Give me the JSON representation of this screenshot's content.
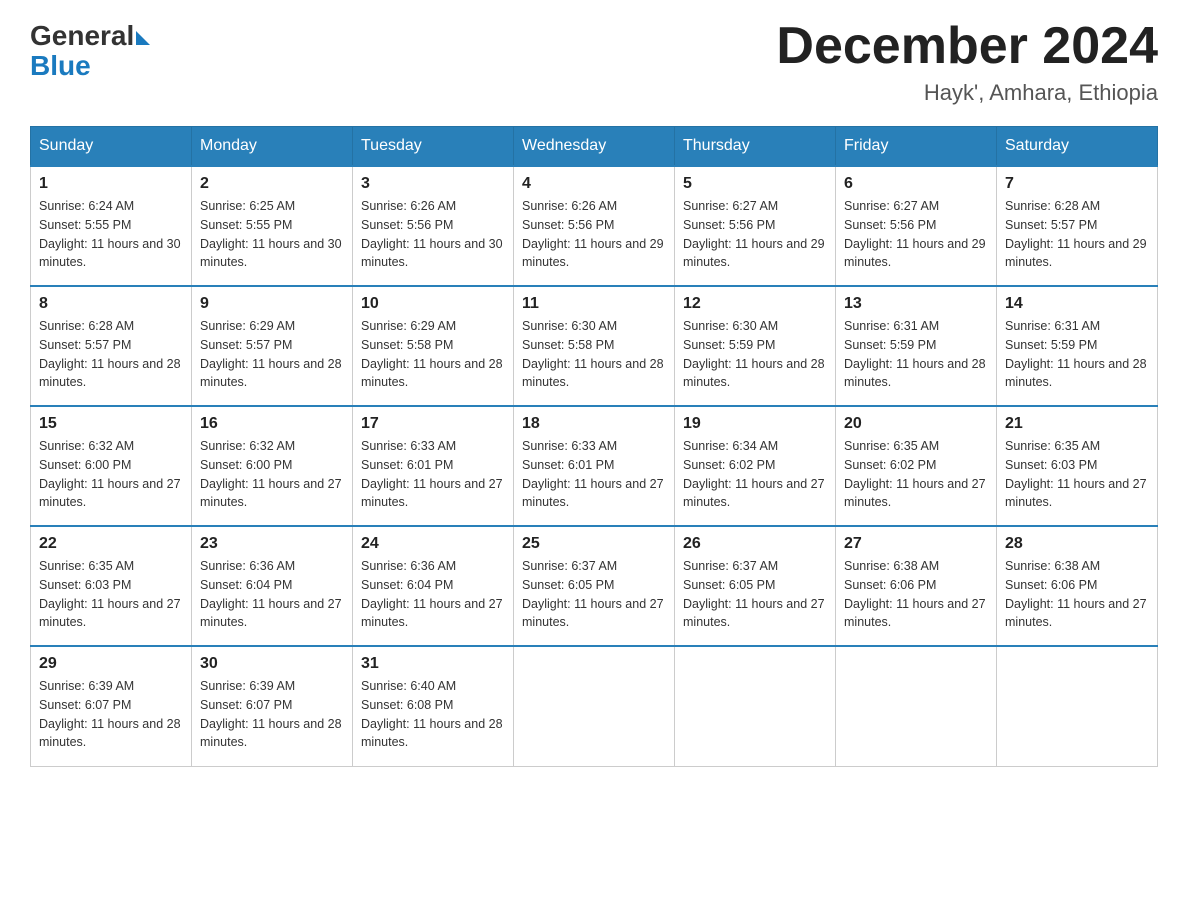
{
  "header": {
    "logo_general": "General",
    "logo_blue": "Blue",
    "month_year": "December 2024",
    "location": "Hayk', Amhara, Ethiopia"
  },
  "weekdays": [
    "Sunday",
    "Monday",
    "Tuesday",
    "Wednesday",
    "Thursday",
    "Friday",
    "Saturday"
  ],
  "weeks": [
    [
      {
        "day": "1",
        "sunrise": "6:24 AM",
        "sunset": "5:55 PM",
        "daylight": "11 hours and 30 minutes."
      },
      {
        "day": "2",
        "sunrise": "6:25 AM",
        "sunset": "5:55 PM",
        "daylight": "11 hours and 30 minutes."
      },
      {
        "day": "3",
        "sunrise": "6:26 AM",
        "sunset": "5:56 PM",
        "daylight": "11 hours and 30 minutes."
      },
      {
        "day": "4",
        "sunrise": "6:26 AM",
        "sunset": "5:56 PM",
        "daylight": "11 hours and 29 minutes."
      },
      {
        "day": "5",
        "sunrise": "6:27 AM",
        "sunset": "5:56 PM",
        "daylight": "11 hours and 29 minutes."
      },
      {
        "day": "6",
        "sunrise": "6:27 AM",
        "sunset": "5:56 PM",
        "daylight": "11 hours and 29 minutes."
      },
      {
        "day": "7",
        "sunrise": "6:28 AM",
        "sunset": "5:57 PM",
        "daylight": "11 hours and 29 minutes."
      }
    ],
    [
      {
        "day": "8",
        "sunrise": "6:28 AM",
        "sunset": "5:57 PM",
        "daylight": "11 hours and 28 minutes."
      },
      {
        "day": "9",
        "sunrise": "6:29 AM",
        "sunset": "5:57 PM",
        "daylight": "11 hours and 28 minutes."
      },
      {
        "day": "10",
        "sunrise": "6:29 AM",
        "sunset": "5:58 PM",
        "daylight": "11 hours and 28 minutes."
      },
      {
        "day": "11",
        "sunrise": "6:30 AM",
        "sunset": "5:58 PM",
        "daylight": "11 hours and 28 minutes."
      },
      {
        "day": "12",
        "sunrise": "6:30 AM",
        "sunset": "5:59 PM",
        "daylight": "11 hours and 28 minutes."
      },
      {
        "day": "13",
        "sunrise": "6:31 AM",
        "sunset": "5:59 PM",
        "daylight": "11 hours and 28 minutes."
      },
      {
        "day": "14",
        "sunrise": "6:31 AM",
        "sunset": "5:59 PM",
        "daylight": "11 hours and 28 minutes."
      }
    ],
    [
      {
        "day": "15",
        "sunrise": "6:32 AM",
        "sunset": "6:00 PM",
        "daylight": "11 hours and 27 minutes."
      },
      {
        "day": "16",
        "sunrise": "6:32 AM",
        "sunset": "6:00 PM",
        "daylight": "11 hours and 27 minutes."
      },
      {
        "day": "17",
        "sunrise": "6:33 AM",
        "sunset": "6:01 PM",
        "daylight": "11 hours and 27 minutes."
      },
      {
        "day": "18",
        "sunrise": "6:33 AM",
        "sunset": "6:01 PM",
        "daylight": "11 hours and 27 minutes."
      },
      {
        "day": "19",
        "sunrise": "6:34 AM",
        "sunset": "6:02 PM",
        "daylight": "11 hours and 27 minutes."
      },
      {
        "day": "20",
        "sunrise": "6:35 AM",
        "sunset": "6:02 PM",
        "daylight": "11 hours and 27 minutes."
      },
      {
        "day": "21",
        "sunrise": "6:35 AM",
        "sunset": "6:03 PM",
        "daylight": "11 hours and 27 minutes."
      }
    ],
    [
      {
        "day": "22",
        "sunrise": "6:35 AM",
        "sunset": "6:03 PM",
        "daylight": "11 hours and 27 minutes."
      },
      {
        "day": "23",
        "sunrise": "6:36 AM",
        "sunset": "6:04 PM",
        "daylight": "11 hours and 27 minutes."
      },
      {
        "day": "24",
        "sunrise": "6:36 AM",
        "sunset": "6:04 PM",
        "daylight": "11 hours and 27 minutes."
      },
      {
        "day": "25",
        "sunrise": "6:37 AM",
        "sunset": "6:05 PM",
        "daylight": "11 hours and 27 minutes."
      },
      {
        "day": "26",
        "sunrise": "6:37 AM",
        "sunset": "6:05 PM",
        "daylight": "11 hours and 27 minutes."
      },
      {
        "day": "27",
        "sunrise": "6:38 AM",
        "sunset": "6:06 PM",
        "daylight": "11 hours and 27 minutes."
      },
      {
        "day": "28",
        "sunrise": "6:38 AM",
        "sunset": "6:06 PM",
        "daylight": "11 hours and 27 minutes."
      }
    ],
    [
      {
        "day": "29",
        "sunrise": "6:39 AM",
        "sunset": "6:07 PM",
        "daylight": "11 hours and 28 minutes."
      },
      {
        "day": "30",
        "sunrise": "6:39 AM",
        "sunset": "6:07 PM",
        "daylight": "11 hours and 28 minutes."
      },
      {
        "day": "31",
        "sunrise": "6:40 AM",
        "sunset": "6:08 PM",
        "daylight": "11 hours and 28 minutes."
      },
      null,
      null,
      null,
      null
    ]
  ]
}
